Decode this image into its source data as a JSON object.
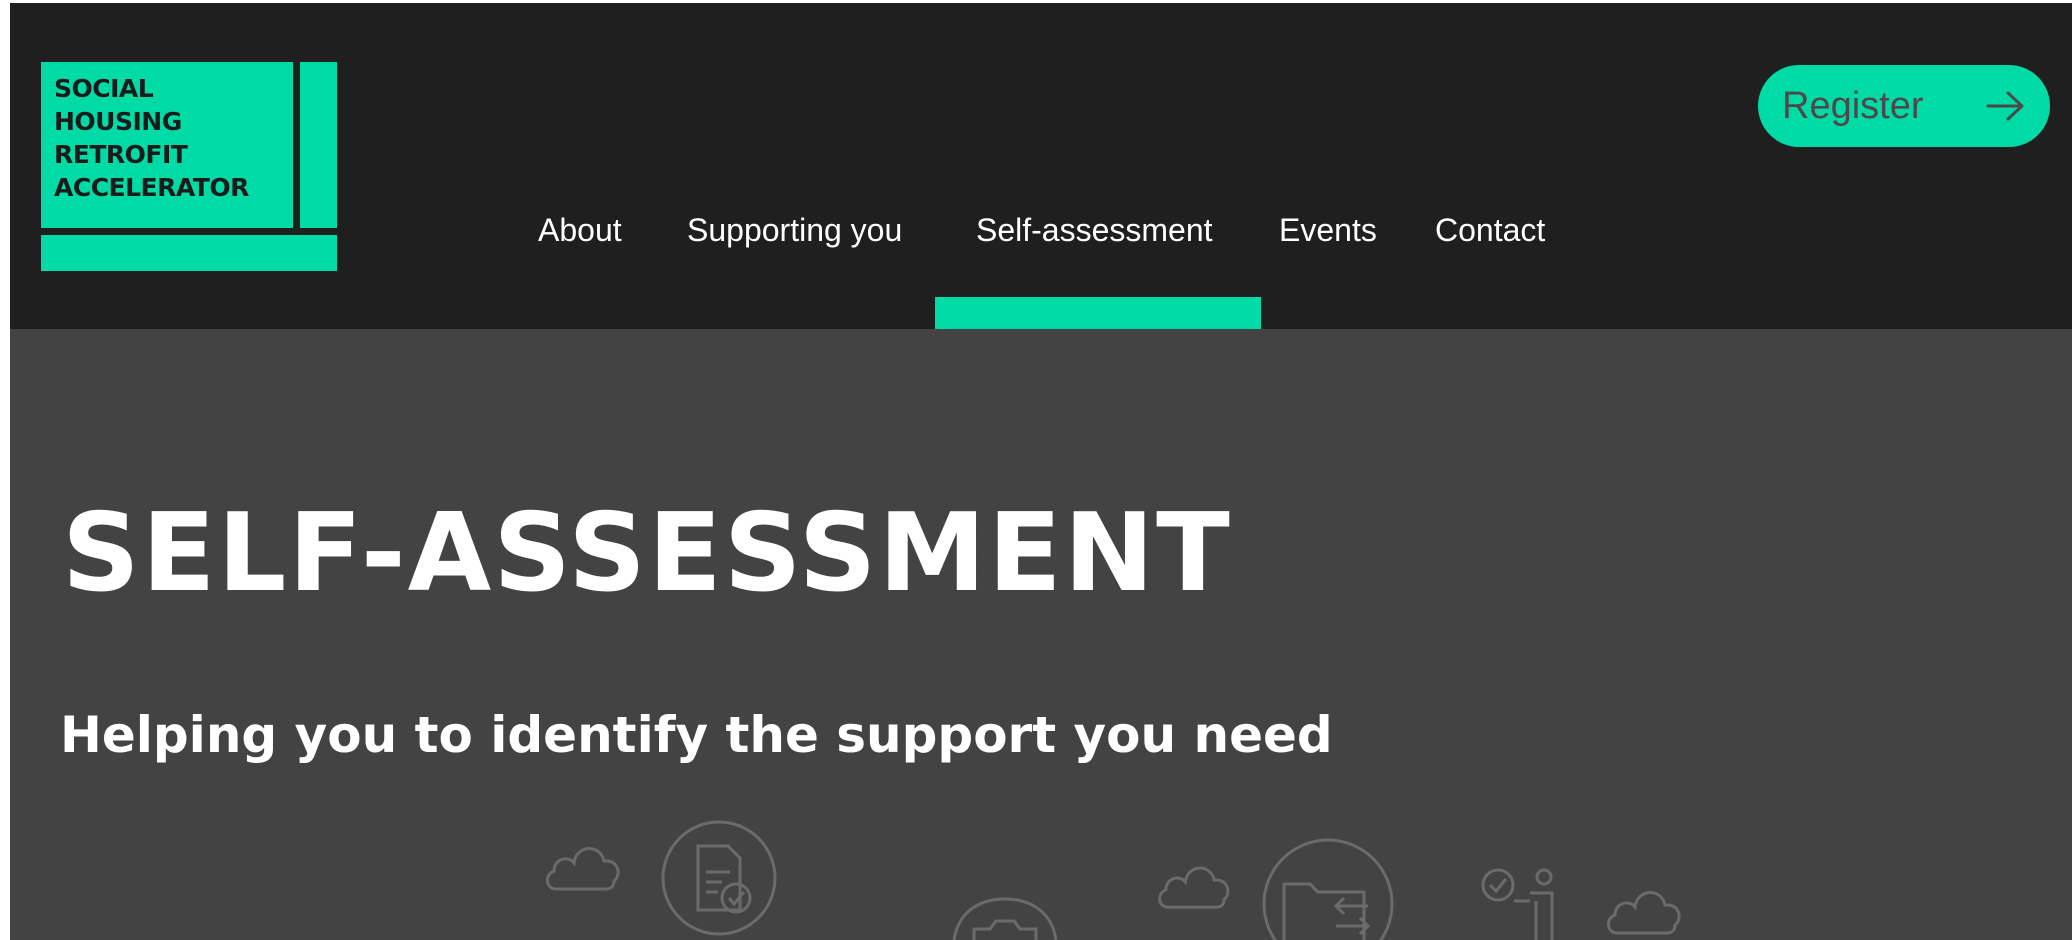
{
  "logo": {
    "lines": [
      "SOCIAL",
      "HOUSING",
      "RETROFIT",
      "ACCELERATOR"
    ]
  },
  "nav": {
    "items": [
      {
        "label": "About"
      },
      {
        "label": "Supporting you"
      },
      {
        "label": "Self-assessment",
        "active": true
      },
      {
        "label": "Events"
      },
      {
        "label": "Contact"
      }
    ]
  },
  "register": {
    "label": "Register"
  },
  "hero": {
    "title": "SELF-ASSESSMENT",
    "subtitle": "Helping you to identify the support you need"
  },
  "icons": [
    "cloud-icon",
    "document-check-icon",
    "cloud-icon",
    "folder-transfer-icon",
    "person-checklist-icon",
    "cloud-icon",
    "camera-icon"
  ],
  "colors": {
    "accent": "#00dba5",
    "header_bg": "#1f1f1f",
    "hero_bg": "#434343",
    "text": "#ffffff"
  }
}
